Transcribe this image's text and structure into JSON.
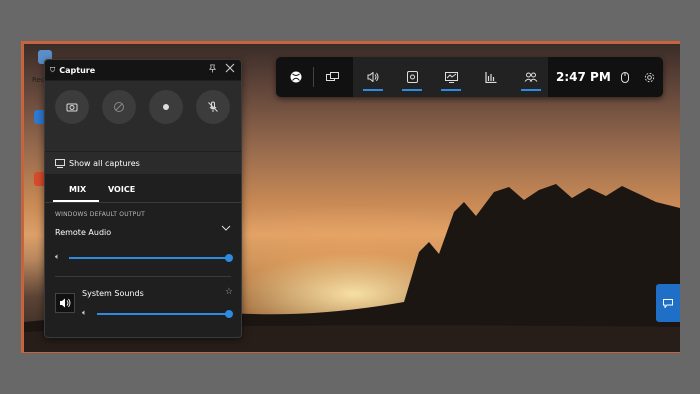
{
  "capture_panel": {
    "title": "Capture",
    "show_all_label": "Show all captures",
    "tabs": [
      {
        "label": "MIX",
        "active": true
      },
      {
        "label": "VOICE",
        "active": false
      }
    ],
    "output_label": "WINDOWS DEFAULT OUTPUT",
    "output_device": "Remote Audio",
    "output_volume": 1.0,
    "apps": [
      {
        "name": "System Sounds",
        "volume": 1.0
      }
    ]
  },
  "topbar": {
    "time": "2:47 PM",
    "widgets": [
      "audio-icon",
      "capture-icon",
      "performance-icon",
      "resources-icon",
      "social-icon"
    ]
  },
  "desktop": {
    "icon_label": "Rec"
  },
  "colors": {
    "accent": "#2d8be0",
    "panel_bg": "#1f1f1f",
    "frame": "#c7643d"
  }
}
